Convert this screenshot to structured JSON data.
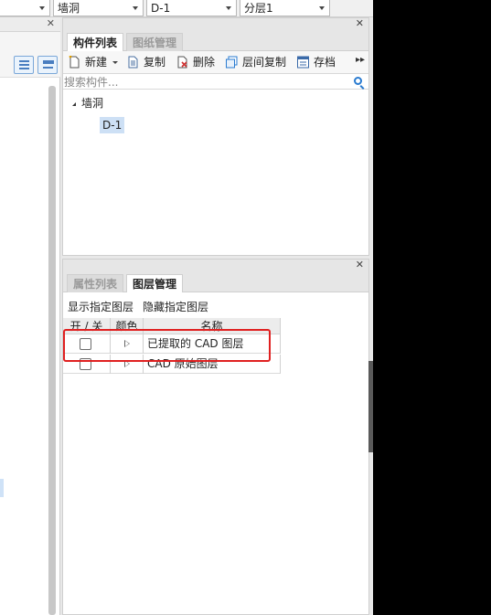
{
  "toolbar": {
    "dropdowns": [
      {
        "value": ""
      },
      {
        "value": "墙洞"
      },
      {
        "value": "D-1"
      },
      {
        "value": "分层1"
      }
    ]
  },
  "component_panel": {
    "tabs": [
      {
        "label": "构件列表",
        "active": true
      },
      {
        "label": "图纸管理",
        "active": false
      }
    ],
    "actions": [
      {
        "label": "新建",
        "icon": "new-icon"
      },
      {
        "label": "复制",
        "icon": "copy-icon"
      },
      {
        "label": "删除",
        "icon": "delete-icon"
      },
      {
        "label": "层间复制",
        "icon": "floor-copy-icon"
      },
      {
        "label": "存档",
        "icon": "archive-icon"
      }
    ],
    "search_placeholder": "搜索构件...",
    "tree": {
      "root": "墙洞",
      "children": [
        "D-1"
      ]
    }
  },
  "layer_panel": {
    "tabs": [
      {
        "label": "属性列表",
        "active": false
      },
      {
        "label": "图层管理",
        "active": true
      }
    ],
    "show_label": "显示指定图层",
    "hide_label": "隐藏指定图层",
    "columns": [
      "开 / 关",
      "颜色",
      "名称"
    ],
    "rows": [
      {
        "name": "已提取的 CAD 图层",
        "checked": false
      },
      {
        "name": "CAD 原始图层",
        "checked": false
      }
    ]
  },
  "colors": {
    "accent": "#2a7bd0",
    "highlight": "#e02020",
    "selection": "#cde0f5"
  }
}
